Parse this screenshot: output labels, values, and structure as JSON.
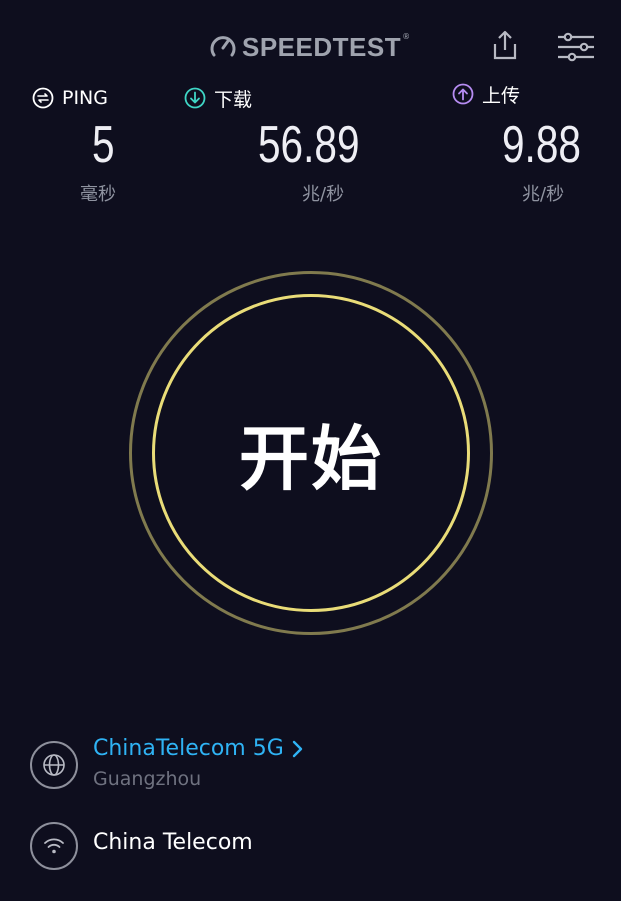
{
  "header": {
    "brand": "SPEEDTEST",
    "reg_mark": "®",
    "brand_color": "#9fa3ae"
  },
  "metrics": {
    "ping": {
      "label": "PING",
      "value": "5",
      "unit": "毫秒",
      "icon": "ping-icon",
      "icon_color": "#ffffff"
    },
    "download": {
      "label": "下载",
      "value": "56.89",
      "unit": "兆/秒",
      "icon": "download-arrow-icon",
      "icon_color": "#3fd6c6"
    },
    "upload": {
      "label": "上传",
      "value": "9.88",
      "unit": "兆/秒",
      "icon": "upload-arrow-icon",
      "icon_color": "#b68cf2"
    }
  },
  "start_button": {
    "label": "开始",
    "outer_ring_color": "#807a4e",
    "inner_ring_color": "#e9dc78"
  },
  "server": {
    "name": "ChinaTelecom 5G",
    "location": "Guangzhou",
    "icon": "globe-icon",
    "accent_color": "#2fb3f4"
  },
  "isp": {
    "name": "China Telecom",
    "icon": "wifi-icon"
  },
  "colors": {
    "background": "#0e0e1e"
  }
}
